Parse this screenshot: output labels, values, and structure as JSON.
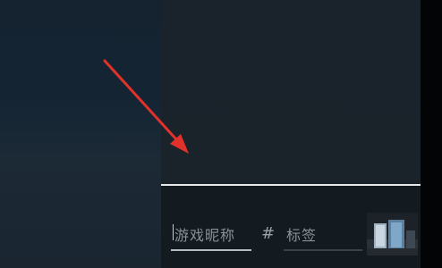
{
  "form": {
    "nickname_placeholder": "游戏昵称",
    "separator": "#",
    "tag_placeholder": "标签"
  },
  "icons": {
    "annotation_arrow": "red-arrow-icon",
    "thumbnail": "game-art-thumbnail"
  },
  "colors": {
    "arrow": "#e0322b",
    "panel_border": "#e8e9ea",
    "placeholder_text": "#8a9096"
  }
}
